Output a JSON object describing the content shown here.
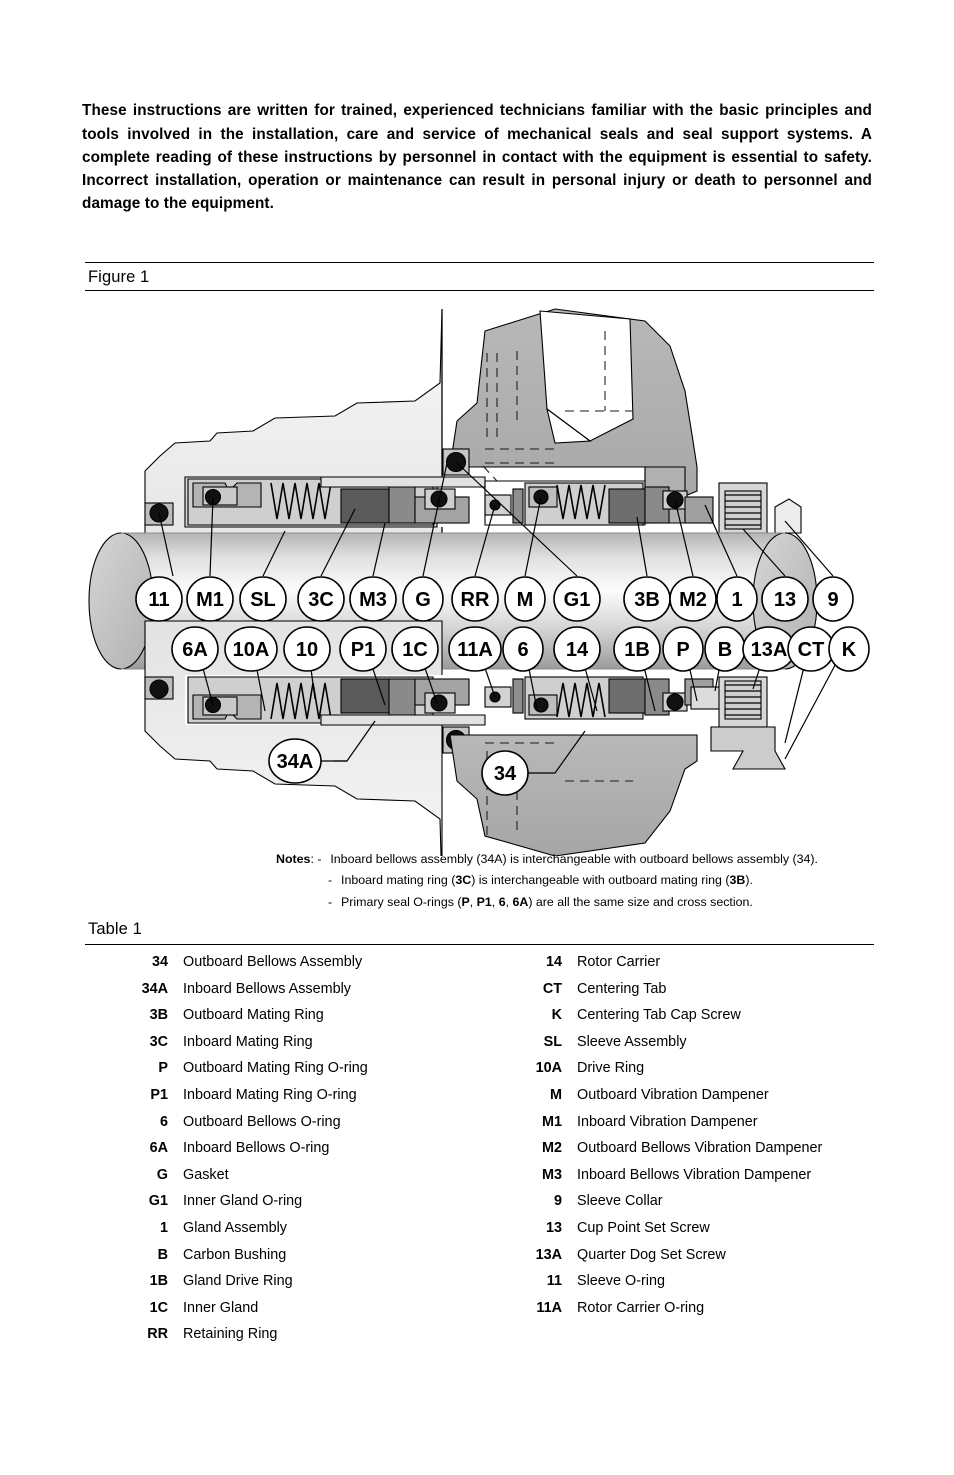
{
  "intro": {
    "paragraph": "These instructions are written for trained, experienced technicians familiar with the basic principles and tools involved in the installation, care and service of mechanical seals and seal support systems. A complete reading of these instructions by personnel in contact with the equipment is essential to safety. Incorrect installation, operation or maintenance can result in personal injury or death to personnel and damage to the equipment."
  },
  "figure": {
    "caption": "Figure 1",
    "callouts_top": [
      "11",
      "M1",
      "SL",
      "3C",
      "M3",
      "G",
      "RR",
      "M",
      "G1",
      "3B",
      "M2",
      "1",
      "13",
      "9"
    ],
    "callouts_bottom": [
      "6A",
      "10A",
      "10",
      "P1",
      "1C",
      "11A",
      "6",
      "14",
      "1B",
      "P",
      "B",
      "13A",
      "CT",
      "K"
    ],
    "callouts_inner": [
      "34A",
      "34"
    ],
    "colors": {
      "housing_light": "#f0f0f0",
      "housing_mid": "#bfbfbf",
      "part_gray": "#a8a8a8",
      "part_dark": "#5a5a5a",
      "part_mid": "#8c8c8c",
      "shaft_light": "#fbfbfb",
      "shaft_dark": "#9d9d9d",
      "outline": "#000000"
    }
  },
  "notes": {
    "label": "Notes",
    "items": [
      {
        "pre": "Inboard bellows assembly (34A) is interchangeable with outboard bellows assembly (34)."
      },
      {
        "pre": "Inboard mating ring (",
        "b1": "3C",
        "mid": ") is interchangeable with outboard mating ring (",
        "b2": "3B",
        "post": ")."
      },
      {
        "pre": "Primary seal O-rings (",
        "b1": "P",
        "s1": ", ",
        "b2": "P1",
        "s2": ", ",
        "b3": "6",
        "s3": ", ",
        "b4": "6A",
        "post": ") are all the same size and cross section."
      }
    ],
    "line1": "Inboard bellows assembly (34A) is interchangeable with outboard bellows assembly (34)."
  },
  "table": {
    "caption": "Table 1",
    "left_column": [
      {
        "key": "34",
        "value": "Outboard Bellows Assembly"
      },
      {
        "key": "34A",
        "value": "Inboard Bellows Assembly"
      },
      {
        "key": "3B",
        "value": "Outboard Mating Ring"
      },
      {
        "key": "3C",
        "value": "Inboard Mating Ring"
      },
      {
        "key": "P",
        "value": "Outboard Mating Ring O-ring"
      },
      {
        "key": "P1",
        "value": "Inboard Mating Ring O-ring"
      },
      {
        "key": "6",
        "value": "Outboard Bellows O-ring"
      },
      {
        "key": "6A",
        "value": "Inboard Bellows O-ring"
      },
      {
        "key": "G",
        "value": "Gasket"
      },
      {
        "key": "G1",
        "value": "Inner Gland O-ring"
      },
      {
        "key": "1",
        "value": "Gland Assembly"
      },
      {
        "key": "B",
        "value": "Carbon Bushing"
      },
      {
        "key": "1B",
        "value": "Gland Drive Ring"
      },
      {
        "key": "1C",
        "value": "Inner Gland"
      },
      {
        "key": "RR",
        "value": "Retaining Ring"
      }
    ],
    "right_column": [
      {
        "key": "14",
        "value": "Rotor Carrier"
      },
      {
        "key": "CT",
        "value": "Centering Tab"
      },
      {
        "key": "K",
        "value": "Centering Tab Cap Screw"
      },
      {
        "key": "SL",
        "value": "Sleeve Assembly"
      },
      {
        "key": "10A",
        "value": "Drive Ring"
      },
      {
        "key": "M",
        "value": "Outboard Vibration Dampener"
      },
      {
        "key": "M1",
        "value": "Inboard Vibration Dampener"
      },
      {
        "key": "M2",
        "value": "Outboard Bellows Vibration Dampener"
      },
      {
        "key": "M3",
        "value": "Inboard Bellows Vibration Dampener"
      },
      {
        "key": "9",
        "value": "Sleeve Collar"
      },
      {
        "key": "13",
        "value": "Cup Point Set Screw"
      },
      {
        "key": "13A",
        "value": "Quarter Dog Set Screw"
      },
      {
        "key": "11",
        "value": "Sleeve O-ring"
      },
      {
        "key": "11A",
        "value": "Rotor Carrier O-ring"
      }
    ]
  }
}
